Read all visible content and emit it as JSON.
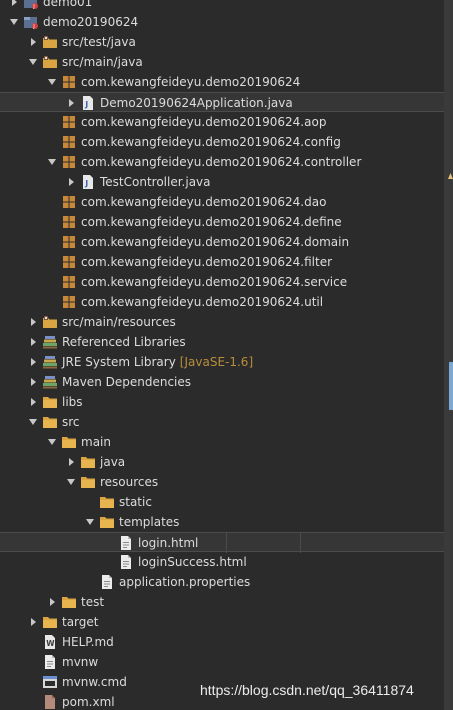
{
  "tree": {
    "rows": [
      {
        "label": "demo01",
        "indent": 0,
        "toggle": "collapsed",
        "icon": "project-icon"
      },
      {
        "label": "demo20190624",
        "indent": 0,
        "toggle": "expanded",
        "icon": "project-icon"
      },
      {
        "label": "src/test/java",
        "indent": 1,
        "toggle": "collapsed",
        "icon": "source-folder-icon"
      },
      {
        "label": "src/main/java",
        "indent": 1,
        "toggle": "expanded",
        "icon": "source-folder-icon"
      },
      {
        "label": "com.kewangfeideyu.demo20190624",
        "indent": 2,
        "toggle": "expanded",
        "icon": "package-icon"
      },
      {
        "label": "Demo20190624Application.java",
        "indent": 3,
        "toggle": "collapsed",
        "icon": "java-file-icon",
        "outlined": true
      },
      {
        "label": "com.kewangfeideyu.demo20190624.aop",
        "indent": 2,
        "toggle": "none",
        "icon": "package-icon"
      },
      {
        "label": "com.kewangfeideyu.demo20190624.config",
        "indent": 2,
        "toggle": "none",
        "icon": "package-icon"
      },
      {
        "label": "com.kewangfeideyu.demo20190624.controller",
        "indent": 2,
        "toggle": "expanded",
        "icon": "package-icon"
      },
      {
        "label": "TestController.java",
        "indent": 3,
        "toggle": "collapsed",
        "icon": "java-file-icon"
      },
      {
        "label": "com.kewangfeideyu.demo20190624.dao",
        "indent": 2,
        "toggle": "none",
        "icon": "package-icon"
      },
      {
        "label": "com.kewangfeideyu.demo20190624.define",
        "indent": 2,
        "toggle": "none",
        "icon": "package-icon"
      },
      {
        "label": "com.kewangfeideyu.demo20190624.domain",
        "indent": 2,
        "toggle": "none",
        "icon": "package-icon"
      },
      {
        "label": "com.kewangfeideyu.demo20190624.filter",
        "indent": 2,
        "toggle": "none",
        "icon": "package-icon"
      },
      {
        "label": "com.kewangfeideyu.demo20190624.service",
        "indent": 2,
        "toggle": "none",
        "icon": "package-icon"
      },
      {
        "label": "com.kewangfeideyu.demo20190624.util",
        "indent": 2,
        "toggle": "none",
        "icon": "package-icon"
      },
      {
        "label": "src/main/resources",
        "indent": 1,
        "toggle": "collapsed",
        "icon": "source-folder-icon"
      },
      {
        "label": "Referenced Libraries",
        "indent": 1,
        "toggle": "collapsed",
        "icon": "library-icon"
      },
      {
        "label": "JRE System Library",
        "decoration": "[JavaSE-1.6]",
        "indent": 1,
        "toggle": "collapsed",
        "icon": "library-icon"
      },
      {
        "label": "Maven Dependencies",
        "indent": 1,
        "toggle": "collapsed",
        "icon": "library-icon"
      },
      {
        "label": "libs",
        "indent": 1,
        "toggle": "collapsed",
        "icon": "folder-icon"
      },
      {
        "label": "src",
        "indent": 1,
        "toggle": "expanded",
        "icon": "folder-icon"
      },
      {
        "label": "main",
        "indent": 2,
        "toggle": "expanded",
        "icon": "folder-icon"
      },
      {
        "label": "java",
        "indent": 3,
        "toggle": "collapsed",
        "icon": "folder-icon"
      },
      {
        "label": "resources",
        "indent": 3,
        "toggle": "expanded",
        "icon": "folder-icon"
      },
      {
        "label": "static",
        "indent": 4,
        "toggle": "none",
        "icon": "folder-icon"
      },
      {
        "label": "templates",
        "indent": 4,
        "toggle": "expanded",
        "icon": "folder-icon"
      },
      {
        "label": "login.html",
        "indent": 5,
        "toggle": "none",
        "icon": "file-icon",
        "selected": true
      },
      {
        "label": "loginSuccess.html",
        "indent": 5,
        "toggle": "none",
        "icon": "file-icon"
      },
      {
        "label": "application.properties",
        "indent": 4,
        "toggle": "none",
        "icon": "properties-file-icon"
      },
      {
        "label": "test",
        "indent": 2,
        "toggle": "collapsed",
        "icon": "folder-icon"
      },
      {
        "label": "target",
        "indent": 1,
        "toggle": "collapsed",
        "icon": "folder-icon"
      },
      {
        "label": "HELP.md",
        "indent": 1,
        "toggle": "none",
        "icon": "markdown-file-icon"
      },
      {
        "label": "mvnw",
        "indent": 1,
        "toggle": "none",
        "icon": "file-icon"
      },
      {
        "label": "mvnw.cmd",
        "indent": 1,
        "toggle": "none",
        "icon": "cmd-file-icon"
      },
      {
        "label": "pom.xml",
        "indent": 1,
        "toggle": "none",
        "icon": "xml-file-icon"
      }
    ]
  },
  "watermark": "https://blog.csdn.net/qq_36411874",
  "colors": {
    "background": "#2b2b2b",
    "text": "#dcdcdc",
    "decoration": "#b98d3b",
    "folder": "#d9a441",
    "package": "#c7883a",
    "scroll_thumb": "#7aa9d6"
  }
}
